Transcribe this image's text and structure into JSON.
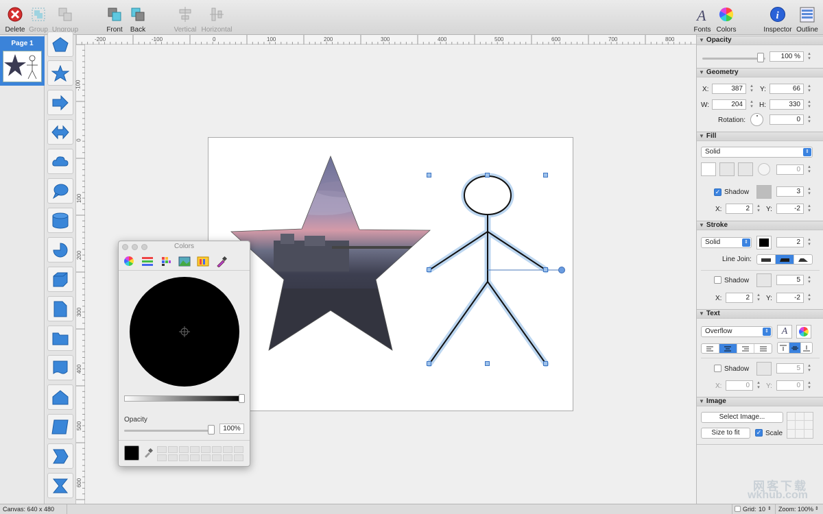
{
  "toolbar": {
    "left": [
      {
        "name": "delete",
        "label": "Delete"
      },
      {
        "name": "group",
        "label": "Group"
      },
      {
        "name": "ungroup",
        "label": "Ungroup"
      },
      {
        "name": "front",
        "label": "Front"
      },
      {
        "name": "back",
        "label": "Back"
      },
      {
        "name": "vertical",
        "label": "Vertical"
      },
      {
        "name": "horizontal",
        "label": "Horizontal"
      }
    ],
    "right": [
      {
        "name": "fonts",
        "label": "Fonts"
      },
      {
        "name": "colors",
        "label": "Colors"
      },
      {
        "name": "inspector",
        "label": "Inspector"
      },
      {
        "name": "outline",
        "label": "Outline"
      }
    ]
  },
  "pages": {
    "items": [
      {
        "label": "Page 1"
      }
    ]
  },
  "palette": {
    "icons": [
      "pentagon-icon",
      "star-icon",
      "arrow-right-icon",
      "double-arrow-icon",
      "cloud-icon",
      "speech-bubble-icon",
      "cylinder-icon",
      "pie-icon",
      "cube-icon",
      "document-icon",
      "folder-icon",
      "banner-icon",
      "home-plate-icon",
      "parallelogram-icon",
      "chevron-icon",
      "bowtie-icon"
    ]
  },
  "rulers": {
    "horizontal": [
      "-200",
      "-100",
      "0",
      "100",
      "200",
      "300",
      "400",
      "500",
      "600",
      "700",
      "800"
    ],
    "vertical": [
      "-100",
      "0",
      "100",
      "200",
      "300",
      "400",
      "500",
      "600"
    ]
  },
  "colors_panel": {
    "title": "Colors",
    "opacity_label": "Opacity",
    "opacity_value": "100%",
    "tabs": [
      "color-wheel-icon",
      "color-sliders-icon",
      "color-palettes-icon",
      "image-palettes-icon",
      "crayons-icon",
      "eyedropper-icon"
    ]
  },
  "inspector": {
    "opacity": {
      "title": "Opacity",
      "value": "100 %"
    },
    "geometry": {
      "title": "Geometry",
      "x_label": "X:",
      "x": "387",
      "y_label": "Y:",
      "y": "66",
      "w_label": "W:",
      "w": "204",
      "h_label": "H:",
      "h": "330",
      "rotation_label": "Rotation:",
      "rotation": "0"
    },
    "fill": {
      "title": "Fill",
      "type": "Solid",
      "gradient_angle": "0",
      "shadow_label": "Shadow",
      "shadow_blur": "3",
      "x_label": "X:",
      "x": "2",
      "y_label": "Y:",
      "y": "-2"
    },
    "stroke": {
      "title": "Stroke",
      "type": "Solid",
      "width": "2",
      "line_join_label": "Line Join:",
      "shadow_label": "Shadow",
      "shadow_blur": "5",
      "x_label": "X:",
      "x": "2",
      "y_label": "Y:",
      "y": "-2"
    },
    "text": {
      "title": "Text",
      "overflow": "Overflow",
      "shadow_label": "Shadow",
      "shadow_blur": "5",
      "x_label": "X:",
      "x": "0",
      "y_label": "Y:",
      "y": "0"
    },
    "image": {
      "title": "Image",
      "select_label": "Select Image...",
      "size_to_fit_label": "Size to fit",
      "scale_label": "Scale"
    }
  },
  "status": {
    "canvas": "Canvas: 640 x 480",
    "grid_label": "Grid:",
    "grid_value": "10",
    "zoom": "Zoom: 100%"
  },
  "watermark": {
    "line1": "网客下载",
    "line2": "wkhub.com"
  }
}
